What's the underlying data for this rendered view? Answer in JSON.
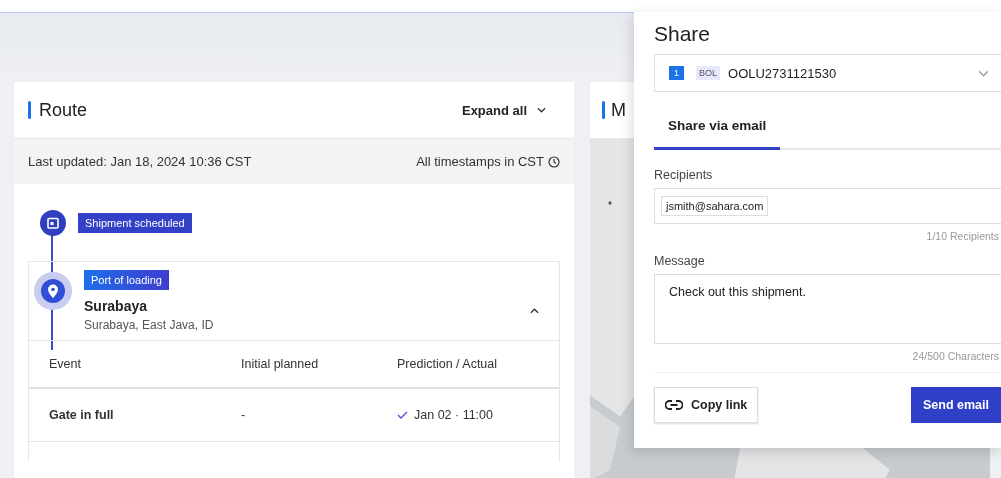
{
  "route": {
    "title": "Route",
    "expand_button": "Expand all",
    "last_updated": "Last updated: Jan 18, 2024 10:36 CST",
    "timezone_note": "All timestamps in CST",
    "milestones": [
      {
        "kind": "scheduled",
        "badge": "Shipment scheduled"
      },
      {
        "kind": "port",
        "badge": "Port of loading",
        "name": "Surabaya",
        "place": "Surabaya, East Java, ID",
        "expanded": true,
        "table": {
          "columns": [
            "Event",
            "Initial planned",
            "Prediction / Actual"
          ],
          "rows": [
            {
              "event": "Gate in full",
              "planned": "-",
              "actual": "Jan 02 · 11:00",
              "done": true
            }
          ]
        }
      }
    ]
  },
  "map_panel": {
    "title": "M"
  },
  "share": {
    "title": "Share",
    "shipment": {
      "count": "1",
      "type": "BOL",
      "number": "OOLU2731121530"
    },
    "tabs": [
      {
        "label": "Share via email",
        "selected": true
      }
    ],
    "recipients_label": "Recipients",
    "recipients": [
      "jsmith@sahara.com"
    ],
    "recipients_count": "1/10 Recipients",
    "message_label": "Message",
    "message": "Check out this shipment.",
    "message_count": "24/500 Characters",
    "copy_button": "Copy link",
    "send_button": "Send email"
  }
}
